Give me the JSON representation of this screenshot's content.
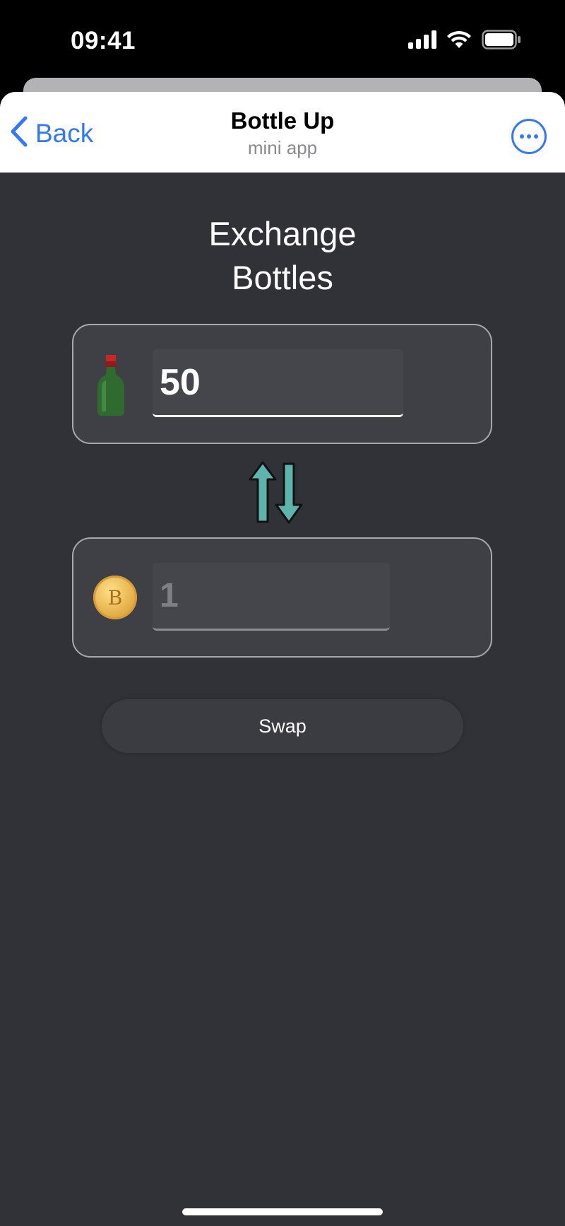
{
  "status_bar": {
    "time": "09:41",
    "icons": [
      "signal-icon",
      "wifi-icon",
      "battery-icon"
    ]
  },
  "nav": {
    "back_label": "Back",
    "title": "Bottle Up",
    "subtitle": "mini app",
    "accent_color": "#3478f6"
  },
  "main": {
    "heading_line1": "Exchange",
    "heading_line2": "Bottles",
    "from": {
      "icon": "bottle-icon",
      "value": "50"
    },
    "to": {
      "icon": "coin-icon",
      "coin_symbol": "B",
      "value": "1"
    },
    "swap_icon": "swap-arrows-icon",
    "swap_button_label": "Swap"
  },
  "colors": {
    "background": "#303237",
    "card": "#3f4046",
    "arrow_fill": "#5fb3ad"
  }
}
